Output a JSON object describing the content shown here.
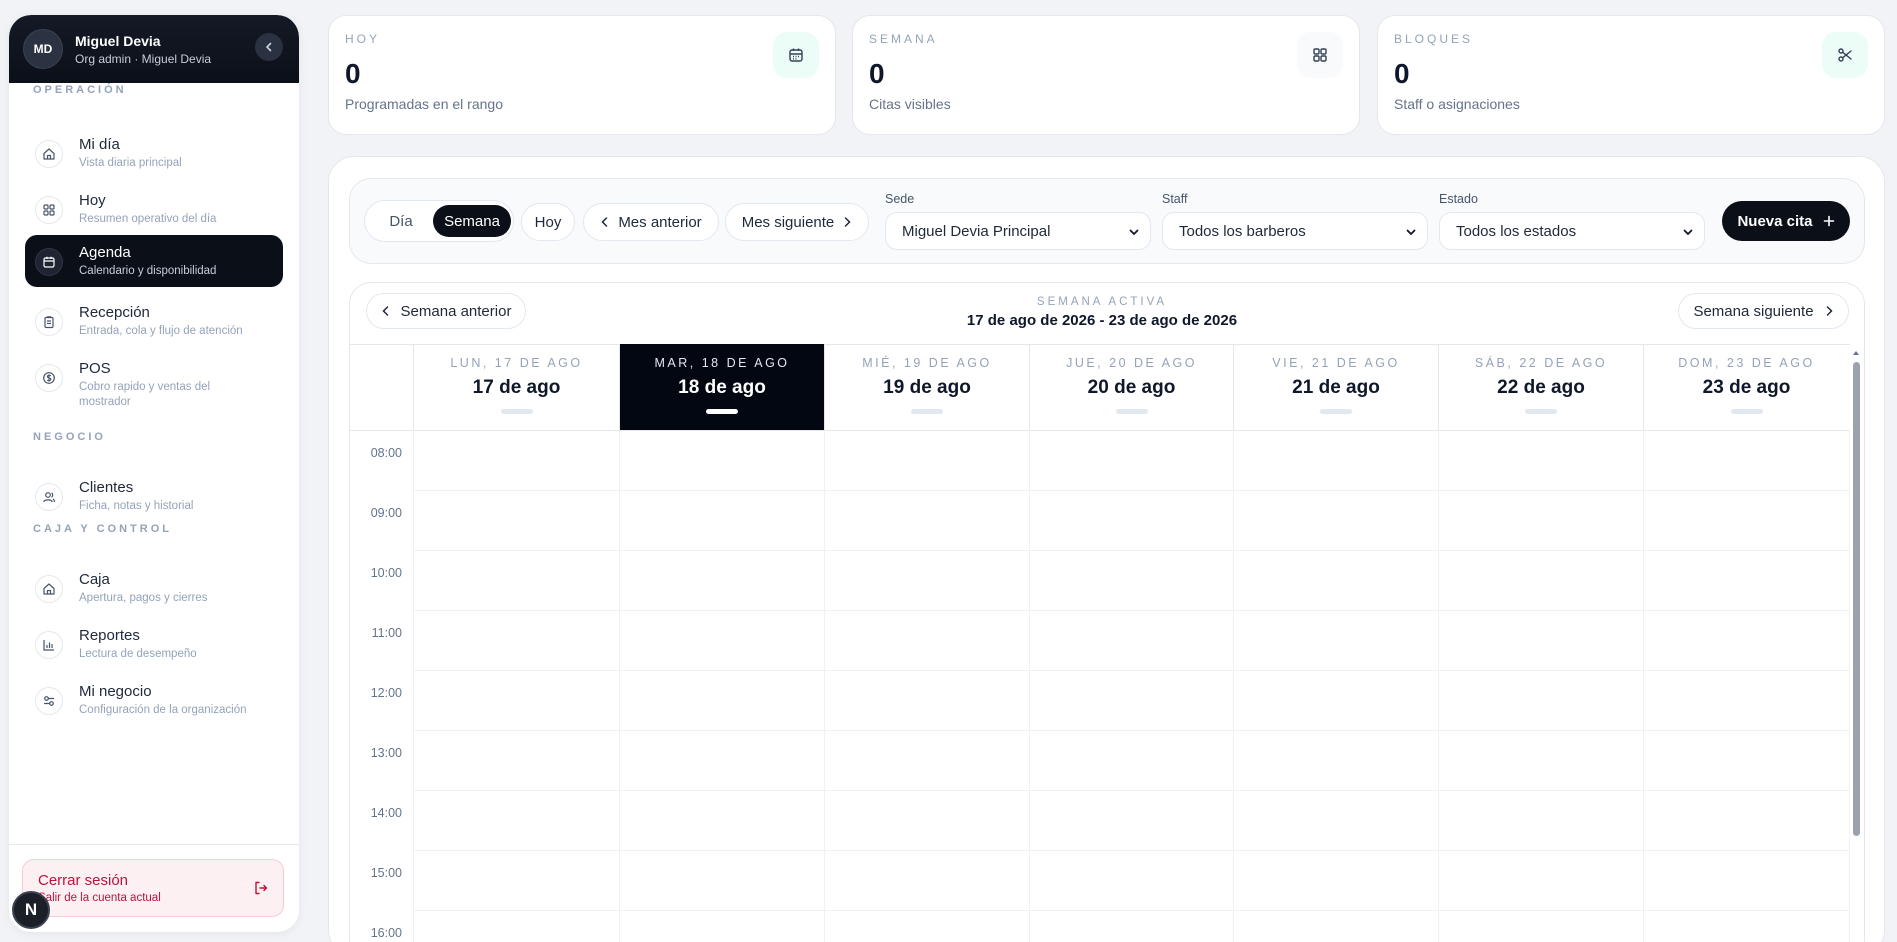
{
  "user": {
    "initials": "MD",
    "name": "Miguel Devia",
    "role": "Org admin · Miguel Devia"
  },
  "sidebar": {
    "sections": [
      {
        "label": "OPERACIÓN"
      },
      {
        "label": "NEGOCIO"
      },
      {
        "label": "CAJA Y CONTROL"
      }
    ],
    "items": [
      {
        "title": "Mi día",
        "subtitle": "Vista diaria principal",
        "icon": "home-icon"
      },
      {
        "title": "Hoy",
        "subtitle": "Resumen operativo del día",
        "icon": "grid-icon"
      },
      {
        "title": "Agenda",
        "subtitle": "Calendario y disponibilidad",
        "icon": "calendar-icon",
        "active": true
      },
      {
        "title": "Recepción",
        "subtitle": "Entrada, cola y flujo de atención",
        "icon": "clipboard-icon"
      },
      {
        "title": "POS",
        "subtitle": "Cobro rapido y ventas del mostrador",
        "icon": "dollar-icon"
      },
      {
        "title": "Clientes",
        "subtitle": "Ficha, notas y historial",
        "icon": "users-icon"
      },
      {
        "title": "Caja",
        "subtitle": "Apertura, pagos y cierres",
        "icon": "home-icon"
      },
      {
        "title": "Reportes",
        "subtitle": "Lectura de desempeño",
        "icon": "bar-chart-icon"
      },
      {
        "title": "Mi negocio",
        "subtitle": "Configuración de la organización",
        "icon": "sliders-icon"
      }
    ],
    "logout": {
      "title": "Cerrar sesión",
      "subtitle": "Salir de la cuenta actual"
    },
    "fab_letter": "N"
  },
  "stats": [
    {
      "label": "HOY",
      "value": "0",
      "subtitle": "Programadas en el rango",
      "icon": "calendar-icon"
    },
    {
      "label": "SEMANA",
      "value": "0",
      "subtitle": "Citas visibles",
      "icon": "grid-icon"
    },
    {
      "label": "BLOQUES",
      "value": "0",
      "subtitle": "Staff o asignaciones",
      "icon": "scissors-icon"
    }
  ],
  "toolbar": {
    "view_day": "Día",
    "view_week": "Semana",
    "today": "Hoy",
    "prev_month": "Mes anterior",
    "next_month": "Mes siguiente",
    "sede_label": "Sede",
    "sede_value": "Miguel Devia Principal",
    "staff_label": "Staff",
    "staff_value": "Todos los barberos",
    "estado_label": "Estado",
    "estado_value": "Todos los estados",
    "new_appointment": "Nueva cita"
  },
  "week": {
    "prev": "Semana anterior",
    "next": "Semana siguiente",
    "active_label": "SEMANA ACTIVA",
    "range": "17 de ago de 2026 - 23 de ago de 2026",
    "days": [
      {
        "weekday": "LUN, 17 DE AGO",
        "date": "17 de ago"
      },
      {
        "weekday": "MAR, 18 DE AGO",
        "date": "18 de ago",
        "today": true
      },
      {
        "weekday": "MIÉ, 19 DE AGO",
        "date": "19 de ago"
      },
      {
        "weekday": "JUE, 20 DE AGO",
        "date": "20 de ago"
      },
      {
        "weekday": "VIE, 21 DE AGO",
        "date": "21 de ago"
      },
      {
        "weekday": "SÁB, 22 DE AGO",
        "date": "22 de ago"
      },
      {
        "weekday": "DOM, 23 DE AGO",
        "date": "23 de ago"
      }
    ],
    "hours": [
      "08:00",
      "09:00",
      "10:00",
      "11:00",
      "12:00",
      "13:00",
      "14:00",
      "15:00",
      "16:00"
    ]
  },
  "colors": {
    "accent_dark": "#0b0f18",
    "danger": "#be123c",
    "icon_bg_teal": "#ecfdf8"
  }
}
